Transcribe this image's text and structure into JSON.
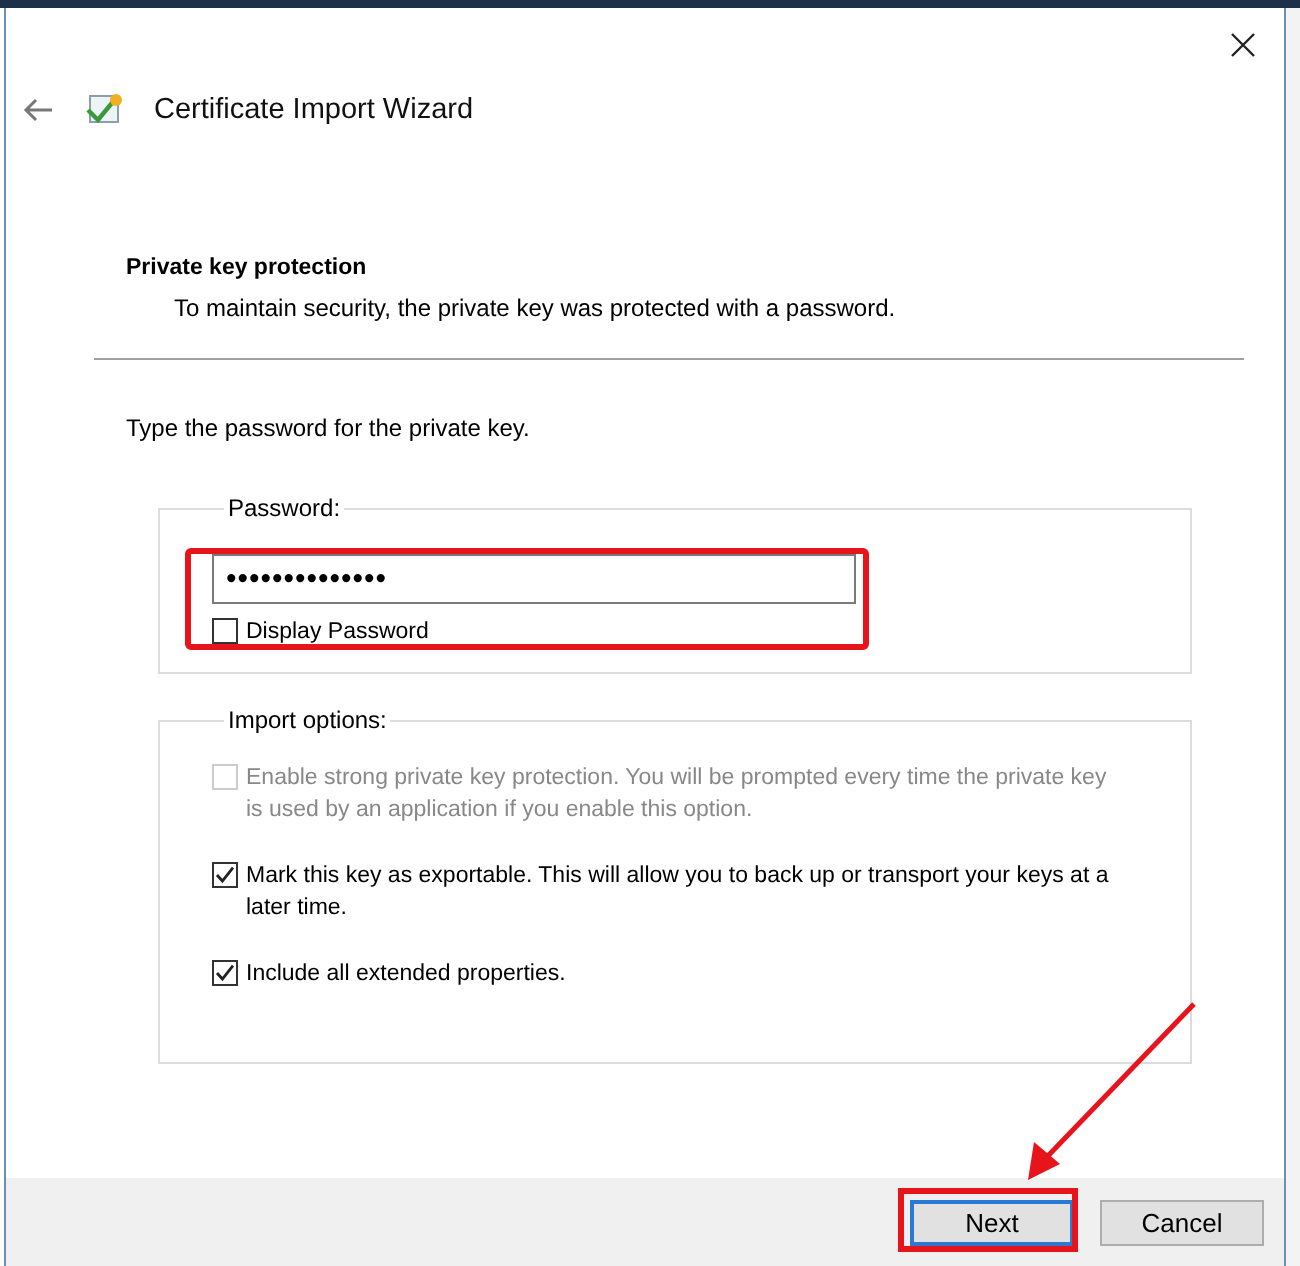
{
  "window": {
    "title": "Certificate Import Wizard"
  },
  "header": {
    "title": "Private key protection",
    "subtitle": "To maintain security, the private key was protected with a password."
  },
  "instruction": "Type the password for the private key.",
  "password_group": {
    "label": "Password:",
    "field": {
      "value": "••••••••••••••"
    },
    "display_password": {
      "label": "Display Password",
      "checked": false
    }
  },
  "import_options": {
    "label": "Import options:",
    "options": [
      {
        "label": "Enable strong private key protection. You will be prompted every time the private key is used by an application if you enable this option.",
        "checked": false,
        "disabled": true
      },
      {
        "label": "Mark this key as exportable. This will allow you to back up or transport your keys at a later time.",
        "checked": true,
        "disabled": false
      },
      {
        "label": "Include all extended properties.",
        "checked": true,
        "disabled": false
      }
    ]
  },
  "buttons": [
    {
      "label": "Next",
      "default": true
    },
    {
      "label": "Cancel",
      "default": false
    }
  ]
}
